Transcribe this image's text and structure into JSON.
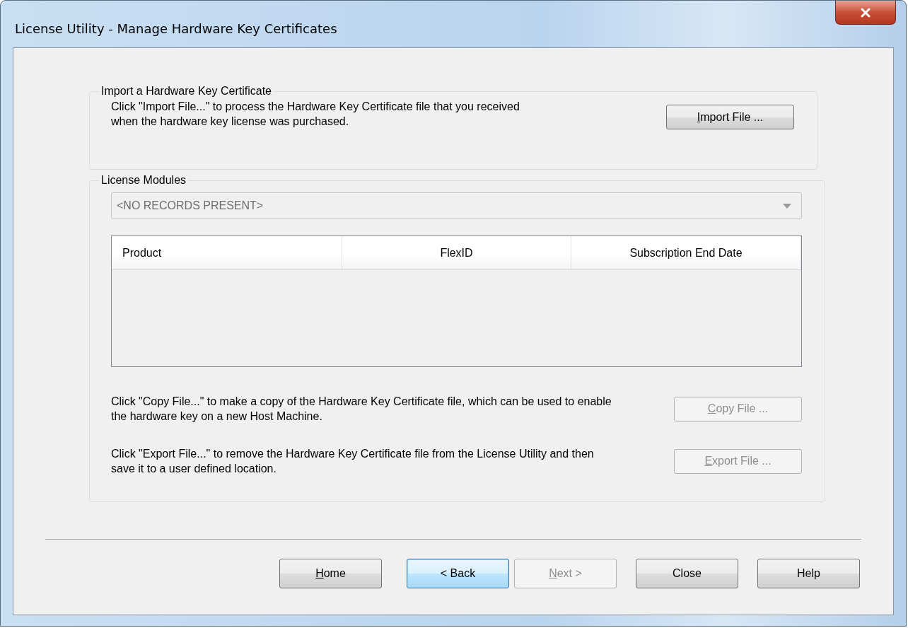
{
  "window": {
    "title": "License Utility - Manage Hardware Key Certificates"
  },
  "import_group": {
    "title": "Import a Hardware Key Certificate",
    "description": "Click \"Import File...\" to process the Hardware Key Certificate file that you received when the hardware key license was purchased.",
    "button": {
      "label": "Import File ...",
      "mnemonic": true,
      "disabled": false
    }
  },
  "modules_group": {
    "title": "License Modules",
    "dropdown": {
      "value": "<NO RECORDS PRESENT>",
      "disabled": true
    },
    "table": {
      "columns": [
        "Product",
        "FlexID",
        "Subscription End Date"
      ]
    },
    "actions": [
      {
        "description": "Click \"Copy File...\" to make a copy of the Hardware Key Certificate file, which can be used to enable the hardware key on a new Host Machine.",
        "button": {
          "label": "Copy File ...",
          "mnemonic": true,
          "disabled": true
        }
      },
      {
        "description": "Click \"Export File...\" to remove the Hardware Key Certificate file from the License Utility and then save it to a user defined location.",
        "button": {
          "label": "Export File ...",
          "mnemonic": true,
          "disabled": true
        }
      }
    ]
  },
  "footer_buttons": [
    {
      "label": "Home",
      "mnemonic": true,
      "disabled": false,
      "focused": false
    },
    {
      "label": "< Back",
      "mnemonic": false,
      "disabled": false,
      "focused": true
    },
    {
      "label": "Next >",
      "mnemonic": true,
      "disabled": true,
      "focused": false
    },
    {
      "label": "Close",
      "mnemonic": false,
      "disabled": false,
      "focused": false
    },
    {
      "label": "Help",
      "mnemonic": false,
      "disabled": false,
      "focused": false
    }
  ]
}
